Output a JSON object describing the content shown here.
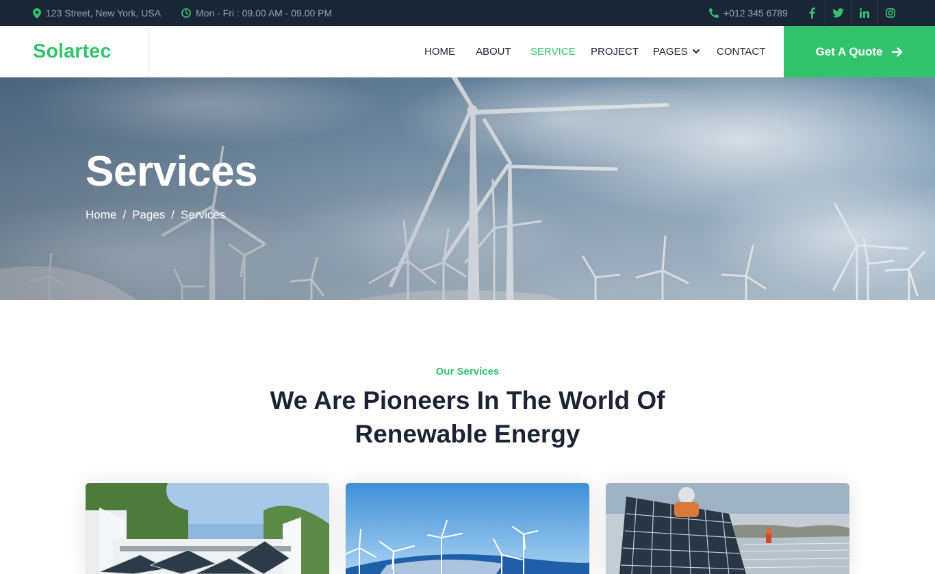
{
  "topbar": {
    "address": "123 Street, New York, USA",
    "hours": "Mon - Fri : 09.00 AM - 09.00 PM",
    "phone": "+012 345 6789",
    "social": [
      "facebook-icon",
      "twitter-icon",
      "linkedin-icon",
      "instagram-icon"
    ]
  },
  "brand": {
    "name": "Solartec"
  },
  "nav": {
    "items": [
      {
        "label": "HOME",
        "active": false
      },
      {
        "label": "ABOUT",
        "active": false
      },
      {
        "label": "SERVICE",
        "active": true
      },
      {
        "label": "PROJECT",
        "active": false
      },
      {
        "label": "PAGES",
        "active": false,
        "dropdown": true
      },
      {
        "label": "CONTACT",
        "active": false
      }
    ],
    "cta_label": "Get A Quote"
  },
  "hero": {
    "title": "Services",
    "breadcrumbs": [
      "Home",
      "Pages",
      "Services"
    ]
  },
  "section": {
    "eyebrow": "Our Services",
    "headline_line1": "We Are Pioneers In The World Of",
    "headline_line2": "Renewable Energy"
  },
  "cards": [
    {
      "image": "solar-building-image"
    },
    {
      "image": "wind-farm-image"
    },
    {
      "image": "solar-installation-image"
    }
  ],
  "colors": {
    "accent": "#32c36c",
    "dark": "#1a2536",
    "text": "#1b2433"
  }
}
